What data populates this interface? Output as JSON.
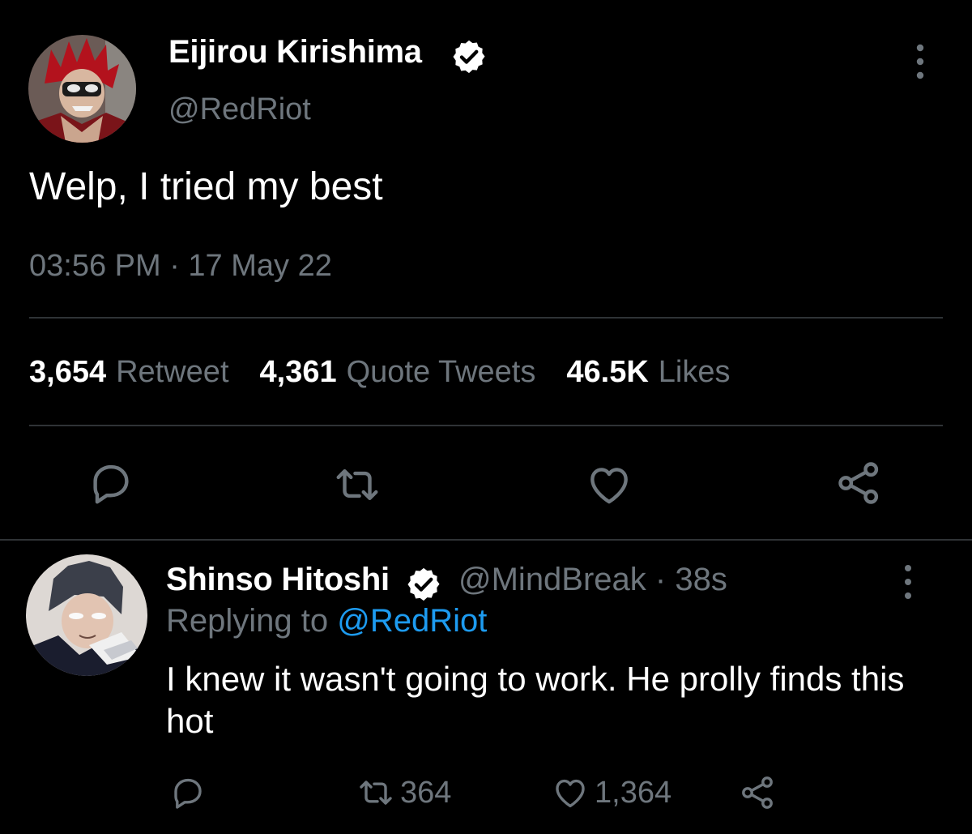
{
  "tweet": {
    "author_name": "Eijirou Kirishima",
    "author_handle": "@RedRiot",
    "text": "Welp, I tried my best",
    "timestamp": "03:56 PM · 17 May 22",
    "stats": {
      "retweets_count": "3,654",
      "retweets_label": "Retweet",
      "quotes_count": "4,361",
      "quotes_label": "Quote Tweets",
      "likes_count": "46.5K",
      "likes_label": "Likes"
    },
    "icons": [
      "reply-icon",
      "retweet-icon",
      "like-icon",
      "share-icon",
      "more-options-icon",
      "verified-badge-icon"
    ]
  },
  "reply": {
    "author_name": "Shinso Hitoshi",
    "author_handle_time": "@MindBreak · 38s",
    "replying_prefix": "Replying to",
    "replying_to": "@RedRiot",
    "text": "I knew it wasn't going to work. He prolly finds this hot",
    "retweets_count": "364",
    "likes_count": "1,364"
  },
  "colors": {
    "background": "#000000",
    "muted": "#6e767d",
    "accent": "#1d9bf0",
    "divider": "#2f3336"
  }
}
